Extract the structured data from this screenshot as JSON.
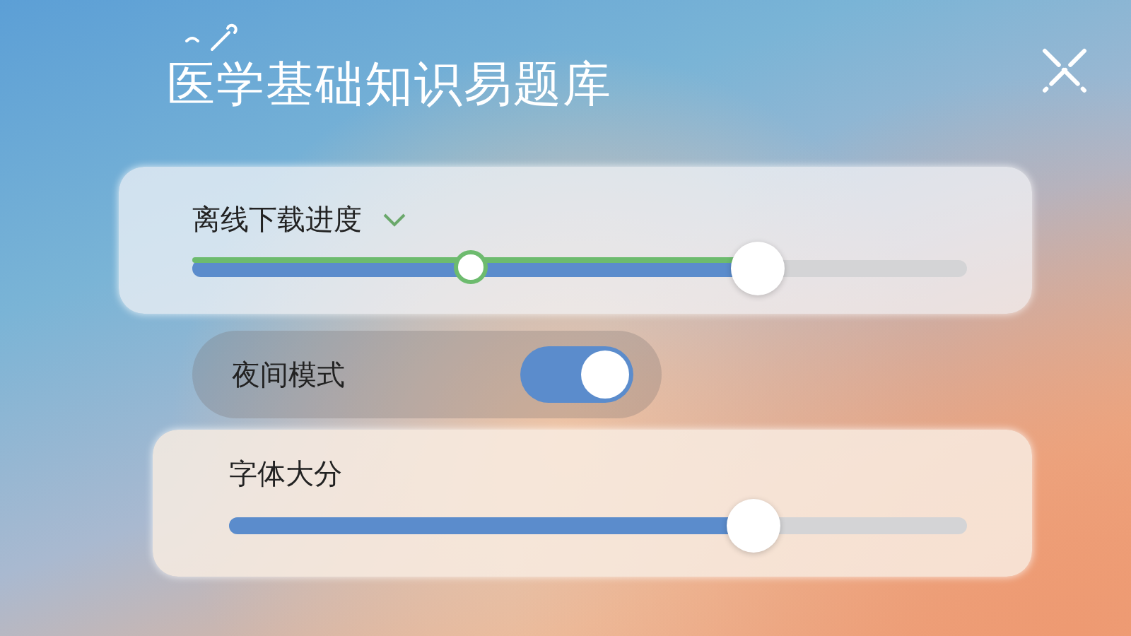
{
  "title": "医学基础知识易题库",
  "download": {
    "label": "离线下载进度",
    "expanded": true,
    "level": 0.73,
    "marker": {
      "level": 0.36
    }
  },
  "night_mode": {
    "label": "夜间模式",
    "on": true
  },
  "font_size": {
    "label": "字体大分",
    "level": 0.71
  }
}
